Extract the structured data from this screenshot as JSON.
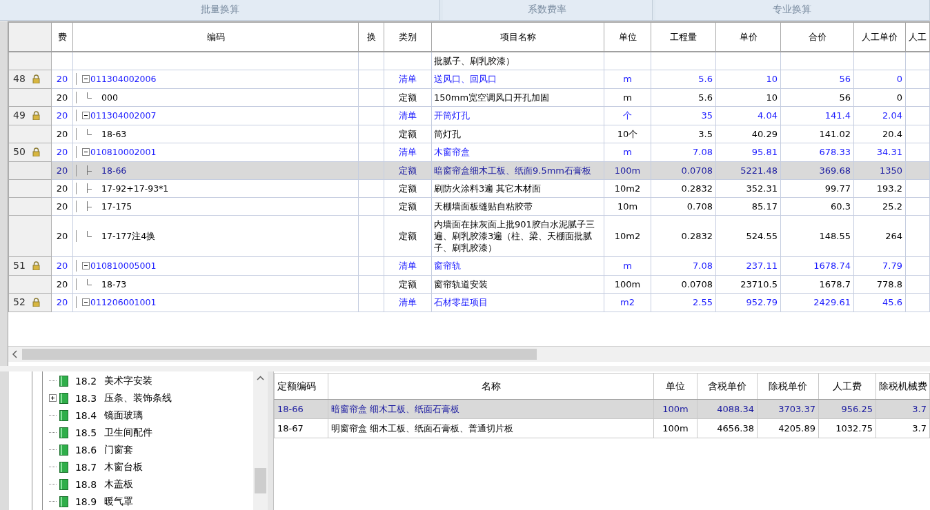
{
  "ribbon_groups": [
    {
      "label": "批量换算"
    },
    {
      "label": "系数费率"
    },
    {
      "label": "专业换算"
    }
  ],
  "main_table": {
    "columns": [
      "费",
      "编码",
      "换",
      "类别",
      "项目名称",
      "单位",
      "工程量",
      "单价",
      "合价",
      "人工单价",
      "人工"
    ],
    "rows": [
      {
        "kind": "continuation",
        "name": "批腻子、刷乳胶漆）",
        "selected": false
      },
      {
        "kind": "bill",
        "number": "48",
        "locked": true,
        "expanded": true,
        "fee": "20",
        "code": "011304002006",
        "category": "清单",
        "name": "送风口、回风口",
        "unit": "m",
        "quantity": "5.6",
        "price": "10",
        "total": "56",
        "labor_price": "0",
        "selected": false,
        "children": [
          {
            "kind": "quota",
            "fee": "20",
            "code": "000",
            "category": "定额",
            "name": "150mm宽空调风口开孔加固",
            "unit": "m",
            "quantity": "5.6",
            "price": "10",
            "total": "56",
            "labor_price": "0",
            "selected": false
          }
        ]
      },
      {
        "kind": "bill",
        "number": "49",
        "locked": true,
        "expanded": true,
        "fee": "20",
        "code": "011304002007",
        "category": "清单",
        "name": "开筒灯孔",
        "unit": "个",
        "quantity": "35",
        "price": "4.04",
        "total": "141.4",
        "labor_price": "2.04",
        "selected": false,
        "children": [
          {
            "kind": "quota",
            "fee": "20",
            "code": "18-63",
            "category": "定额",
            "name": "筒灯孔",
            "unit": "10个",
            "quantity": "3.5",
            "price": "40.29",
            "total": "141.02",
            "labor_price": "20.4",
            "selected": false
          }
        ]
      },
      {
        "kind": "bill",
        "number": "50",
        "locked": true,
        "expanded": true,
        "fee": "20",
        "code": "010810002001",
        "category": "清单",
        "name": "木窗帘盒",
        "unit": "m",
        "quantity": "7.08",
        "price": "95.81",
        "total": "678.33",
        "labor_price": "34.31",
        "selected": false,
        "children": [
          {
            "kind": "quota",
            "fee": "20",
            "code": "18-66",
            "category": "定额",
            "name": "暗窗帘盒细木工板、纸面9.5mm石膏板",
            "unit": "100m",
            "quantity": "0.0708",
            "price": "5221.48",
            "total": "369.68",
            "labor_price": "1350",
            "selected": true
          },
          {
            "kind": "quota",
            "fee": "20",
            "code": "17-92+17-93*1",
            "category": "定额",
            "name": "刷防火涂料3遍 其它木材面",
            "unit": "10m2",
            "quantity": "0.2832",
            "price": "352.31",
            "total": "99.77",
            "labor_price": "193.2",
            "selected": false
          },
          {
            "kind": "quota",
            "fee": "20",
            "code": "17-175",
            "category": "定额",
            "name": "天棚墙面板缝贴自粘胶带",
            "unit": "10m",
            "quantity": "0.708",
            "price": "85.17",
            "total": "60.3",
            "labor_price": "25.2",
            "selected": false
          },
          {
            "kind": "quota",
            "fee": "20",
            "code": "17-177注4换",
            "category": "定额",
            "name": "内墙面在抹灰面上批901胶白水泥腻子三遍、刷乳胶漆3遍（柱、梁、天棚面批腻子、刷乳胶漆）",
            "unit": "10m2",
            "quantity": "0.2832",
            "price": "524.55",
            "total": "148.55",
            "labor_price": "264",
            "selected": false
          }
        ]
      },
      {
        "kind": "bill",
        "number": "51",
        "locked": true,
        "expanded": true,
        "fee": "20",
        "code": "010810005001",
        "category": "清单",
        "name": "窗帘轨",
        "unit": "m",
        "quantity": "7.08",
        "price": "237.11",
        "total": "1678.74",
        "labor_price": "7.79",
        "selected": false,
        "children": [
          {
            "kind": "quota",
            "fee": "20",
            "code": "18-73",
            "category": "定额",
            "name": "窗帘轨道安装",
            "unit": "100m",
            "quantity": "0.0708",
            "price": "23710.5",
            "total": "1678.7",
            "labor_price": "778.8",
            "selected": false
          }
        ]
      },
      {
        "kind": "bill",
        "number": "52",
        "locked": true,
        "expanded": true,
        "fee": "20",
        "code": "011206001001",
        "category": "清单",
        "name": "石材零星项目",
        "unit": "m2",
        "quantity": "2.55",
        "price": "952.79",
        "total": "2429.61",
        "labor_price": "45.6",
        "selected": false
      }
    ]
  },
  "chapter_tree": {
    "items": [
      {
        "number": "18.2",
        "label": "美术字安装",
        "has_children": false
      },
      {
        "number": "18.3",
        "label": "压条、装饰条线",
        "has_children": true
      },
      {
        "number": "18.4",
        "label": "镜面玻璃",
        "has_children": false
      },
      {
        "number": "18.5",
        "label": "卫生间配件",
        "has_children": false
      },
      {
        "number": "18.6",
        "label": "门窗套",
        "has_children": false
      },
      {
        "number": "18.7",
        "label": "木窗台板",
        "has_children": false
      },
      {
        "number": "18.8",
        "label": "木盖板",
        "has_children": false
      },
      {
        "number": "18.9",
        "label": "暖气罩",
        "has_children": false
      }
    ]
  },
  "quota_table": {
    "columns": [
      "定额编码",
      "名称",
      "单位",
      "含税单价",
      "除税单价",
      "人工费",
      "除税机械费"
    ],
    "rows": [
      {
        "code": "18-66",
        "name": "暗窗帘盒 细木工板、纸面石膏板",
        "unit": "100m",
        "tax_price": "4088.34",
        "net_price": "3703.37",
        "labor": "956.25",
        "machine": "3.7",
        "selected": true
      },
      {
        "code": "18-67",
        "name": "明窗帘盒 细木工板、纸面石膏板、普通切片板",
        "unit": "100m",
        "tax_price": "4656.38",
        "net_price": "4205.89",
        "labor": "1032.75",
        "machine": "3.7",
        "selected": false
      }
    ]
  }
}
